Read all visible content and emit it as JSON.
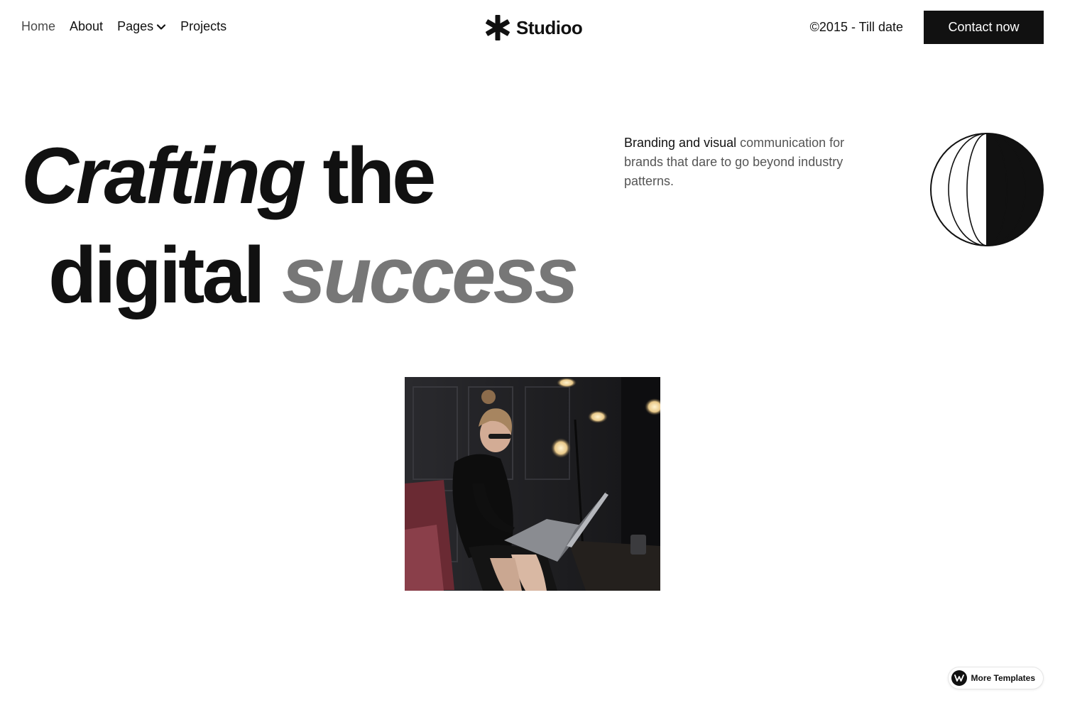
{
  "nav": {
    "links": [
      {
        "label": "Home",
        "active": true
      },
      {
        "label": "About"
      },
      {
        "label": "Pages",
        "dropdown": true
      },
      {
        "label": "Projects"
      }
    ],
    "brand": "Studioo",
    "years": "©2015 - Till date",
    "contact_label": "Contact now"
  },
  "hero": {
    "word1": "Crafting",
    "word2": "the",
    "word3": "digital",
    "word4": "success",
    "intro_strong": "Branding and visual",
    "intro_rest": " communication for brands that dare to go beyond industry patterns."
  },
  "photo": {
    "subject_icon": "woman-with-laptop-photo"
  },
  "badge": {
    "label": "More Templates"
  },
  "colors": {
    "accent": "#111111",
    "muted": "#777777",
    "body_text": "#555555",
    "background": "#ffffff"
  }
}
